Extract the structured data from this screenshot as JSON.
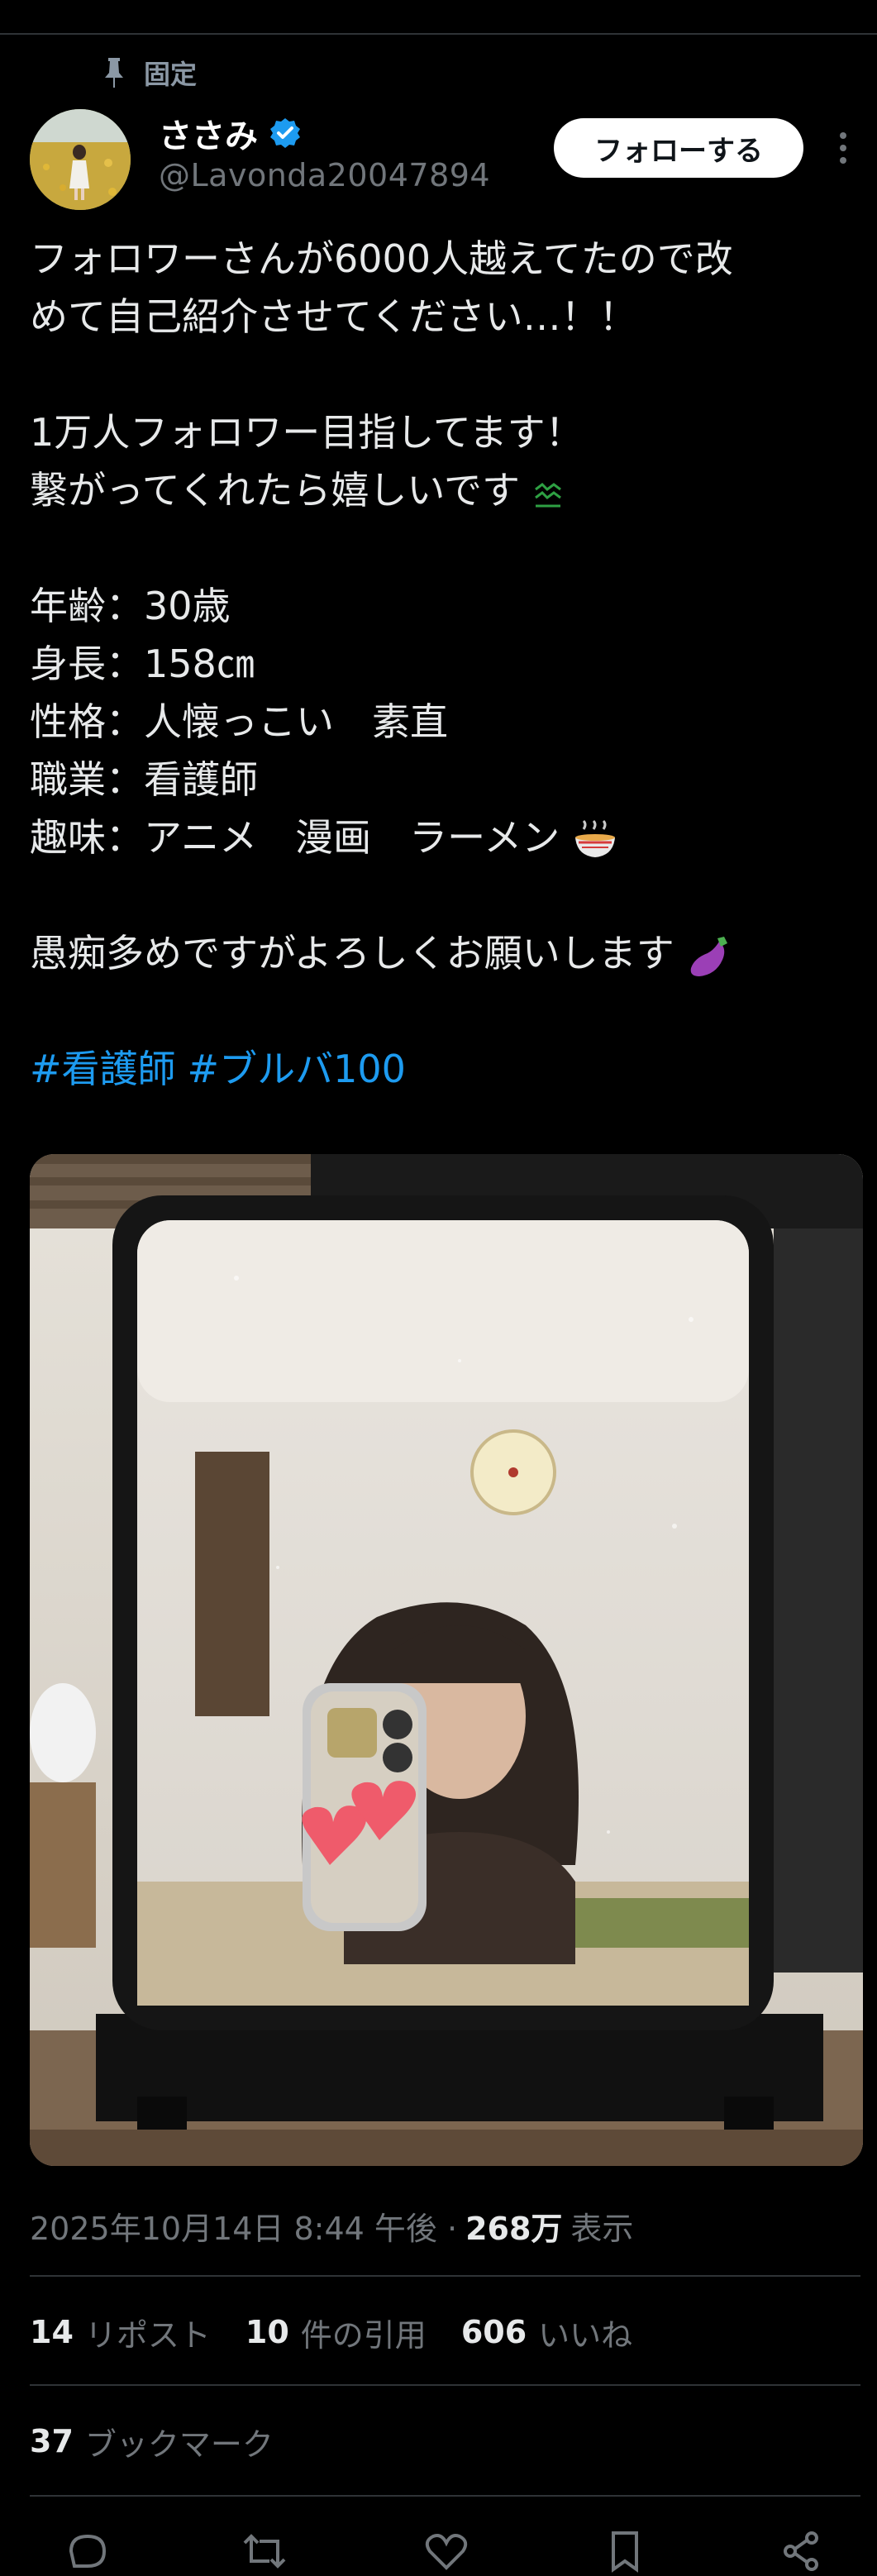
{
  "pinned_label": "固定",
  "author": {
    "name": "ささみ",
    "handle": "@Lavonda20047894"
  },
  "follow_label": "フォローする",
  "tweet": {
    "lines": [
      "フォロワーさんが6000人越えてたので改",
      "めて自己紹介させてください…！！",
      "",
      "1万人フォロワー目指してます！",
      "繋がってくれたら嬉しいです",
      "",
      "年齢：30歳",
      "身長：158㎝",
      "性格：人懐っこい　素直",
      "職業：看護師",
      "趣味：アニメ　漫画　ラーメン",
      "",
      "愚痴多めですがよろしくお願いします"
    ],
    "hashtags": [
      "#看護師",
      "#ブルバ100"
    ]
  },
  "meta": {
    "datetime": "2025年10月14日 8:44 午後 · ",
    "views": "268万",
    "views_label": "表示"
  },
  "stats": {
    "reposts": "14",
    "reposts_label": "リポスト",
    "quotes": "10",
    "quotes_label": "件の引用",
    "likes": "606",
    "likes_label": "いいね",
    "bookmarks": "37",
    "bookmarks_label": "ブックマーク"
  },
  "icons": {
    "pin": "pin-icon",
    "verified": "verified-badge-icon",
    "more": "more-vertical-icon",
    "reply": "reply-icon",
    "repost": "repost-icon",
    "like": "heart-icon",
    "bookmark": "bookmark-icon",
    "share": "share-icon",
    "emoji_line5": "zzz-green-emoji",
    "emoji_line11": "ramen-emoji",
    "emoji_line13": "eggplant-emoji"
  },
  "colors": {
    "accent": "#1d9bf0",
    "background": "#000000",
    "text": "#e7e9ea",
    "muted": "#71767b"
  }
}
